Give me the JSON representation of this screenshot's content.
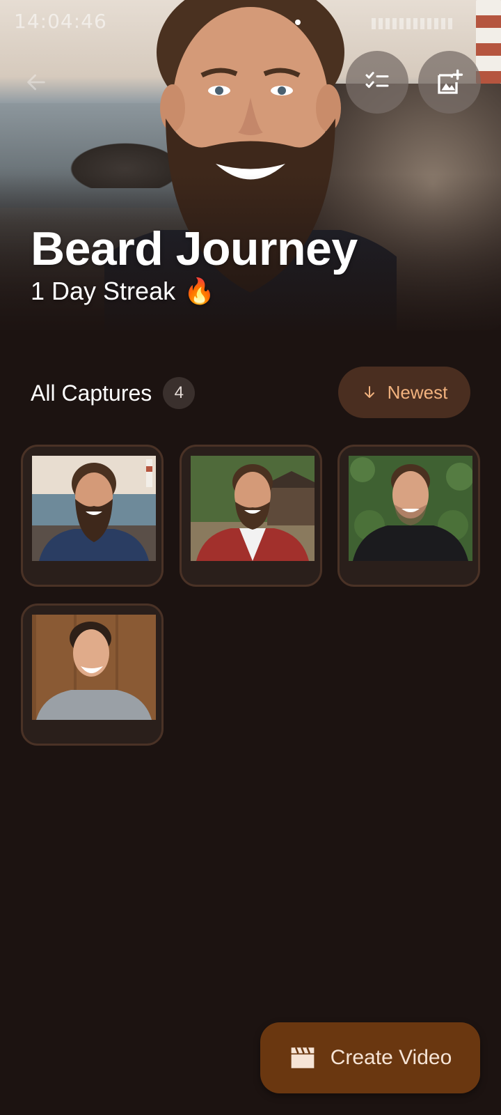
{
  "status_bar": {
    "time": "14:04:46"
  },
  "header": {
    "title": "Beard Journey",
    "subtitle": "1 Day Streak",
    "streak_emoji": "🔥"
  },
  "captures": {
    "section_title": "All Captures",
    "count": "4",
    "sort_label": "Newest",
    "items": [
      {
        "scene": "seaside-lighthouse",
        "beard": "full"
      },
      {
        "scene": "forest-cabin",
        "beard": "short"
      },
      {
        "scene": "ivy-wall",
        "beard": "stubble"
      },
      {
        "scene": "wood-panel",
        "beard": "clean-shaven"
      }
    ]
  },
  "fab": {
    "label": "Create Video"
  },
  "icons": {
    "back": "arrow-left-icon",
    "checklist": "checklist-icon",
    "add_photo": "add-photo-icon",
    "sort": "arrow-down-icon",
    "video": "clapperboard-icon"
  },
  "colors": {
    "background": "#1c1311",
    "accent": "#f2b27e",
    "sort_bg": "#4a2e20",
    "fab_bg": "#6a3710",
    "card_border": "#4a3226"
  }
}
